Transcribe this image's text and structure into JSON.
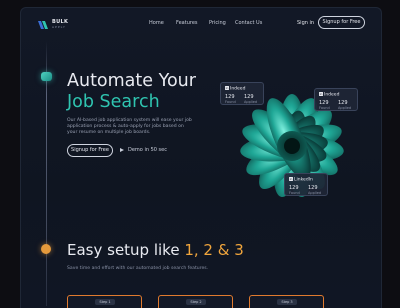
{
  "brand": {
    "name": "BULK",
    "tagline": "APPLY"
  },
  "nav": {
    "links": [
      "Home",
      "Features",
      "Pricing",
      "Contact Us"
    ],
    "sign_in": "Sign in",
    "sign_up": "Signup for Free"
  },
  "hero": {
    "title_line1": "Automate Your",
    "title_line2": "Job Search",
    "description_lines": [
      "Our AI-based job application system will ease your job",
      "application process & auto-apply for jobs based on",
      "your resume on multiple job boards."
    ],
    "cta_primary": "Signup for Free",
    "cta_demo": "Demo in 50 sec"
  },
  "stats": [
    {
      "board": "Indeed",
      "found": "129",
      "found_label": "Found",
      "applied": "129",
      "applied_label": "Applied"
    },
    {
      "board": "Indeed",
      "found": "129",
      "found_label": "Found",
      "applied": "129",
      "applied_label": "Applied"
    },
    {
      "board": "LinkedIn",
      "found": "129",
      "found_label": "Found",
      "applied": "129",
      "applied_label": "Applied"
    }
  ],
  "setup": {
    "title_prefix": "Easy setup like ",
    "title_accent": "1, 2 & 3",
    "subtitle": "Save time and effort with our automated job search features.",
    "steps": [
      "Step 1",
      "Step 2",
      "Step 3"
    ]
  },
  "colors": {
    "accent_teal": "#2fc4b0",
    "accent_orange": "#f0a53c",
    "step_border": "#e07a2e",
    "background": "#121826"
  }
}
